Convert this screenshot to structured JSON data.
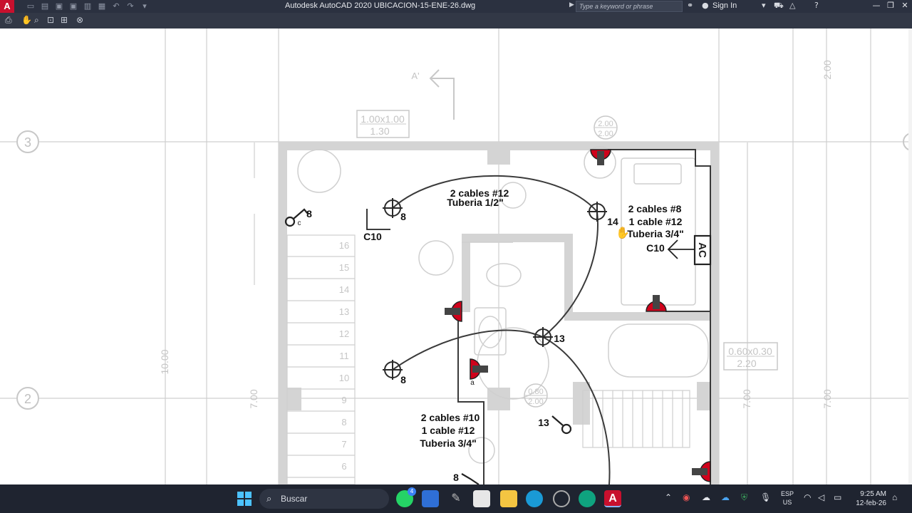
{
  "titlebar": {
    "logo": "A",
    "app_title": "Autodesk AutoCAD 2020    UBICACION-15-ENE-26.dwg",
    "search_placeholder": "Type a keyword or phrase",
    "signin": "Sign In",
    "qat_icons": [
      "new-icon",
      "open-icon",
      "save-icon",
      "save-as-icon",
      "plot-icon",
      "print-icon",
      "undo-icon",
      "redo-icon",
      "dropdown-icon"
    ]
  },
  "drawing": {
    "grid_bubbles": [
      "3",
      "2"
    ],
    "dims": {
      "window_1": "1.00x1.00",
      "window_1_sill": "1.30",
      "window_2": "2.00",
      "window_2_b": "2.00",
      "window_3": "0.60x0.30",
      "window_3_sill": "2.20",
      "door_1": "0.80",
      "door_1_b": "2.00",
      "dim_top": "2.00",
      "dim_left": "10.00",
      "dim_7_a": "7.00",
      "dim_7_b": "7.00",
      "dim_7_c": "7.00"
    },
    "section_mark": "A'",
    "stair_steps": [
      "16",
      "15",
      "14",
      "13",
      "12",
      "11",
      "10",
      "9",
      "8",
      "7",
      "6"
    ],
    "labels": {
      "cable_a_line1": "2 cables #12",
      "cable_a_line2": "Tuberia 1/2\"",
      "cable_b_line1": "2 cables #8",
      "cable_b_line2": "1 cable #12",
      "cable_b_line3": "Tuberia 3/4\"",
      "cable_c_line1": "2 cables #10",
      "cable_c_line2": "1 cable #12",
      "cable_c_line3": "Tuberia 3/4\"",
      "c10_a": "C10",
      "c10_b": "C10",
      "ac": "AC",
      "n8_a": "8",
      "n8_b": "8",
      "n8_c": "8",
      "n8_d": "8",
      "n14": "14",
      "n13_a": "13",
      "n13_b": "13",
      "switch_c": "c",
      "outlet_a": "a"
    }
  },
  "taskbar": {
    "search": "Buscar",
    "whatsapp_badge": "4",
    "lang_line1": "ESP",
    "lang_line2": "US",
    "time": "9:25 AM",
    "date": "12-feb-26"
  },
  "colors": {
    "titlebar": "#2b3140",
    "accent": "#c8102e",
    "fixture_red": "#d0021b",
    "grid_gray": "#c8c8c8"
  }
}
